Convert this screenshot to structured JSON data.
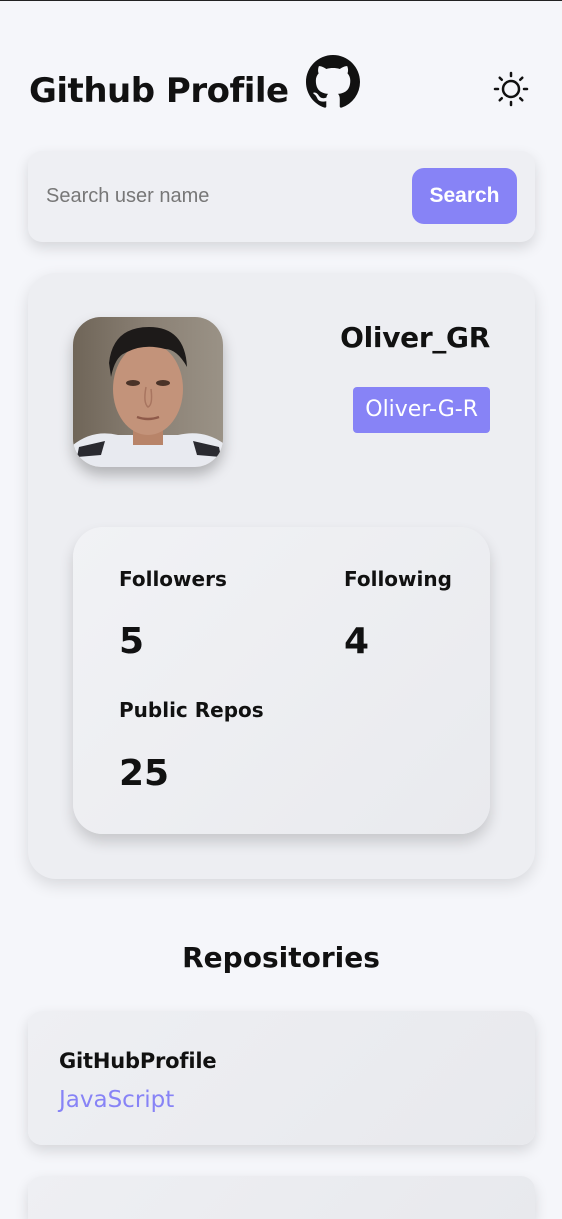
{
  "header": {
    "title": "Github Profile",
    "logo_icon": "github-octocat-icon",
    "theme_icon": "sun-icon"
  },
  "search": {
    "placeholder": "Search user name",
    "value": "",
    "button_label": "Search"
  },
  "profile": {
    "name": "Oliver_GR",
    "login": "Oliver-G-R",
    "avatar_alt": "Avatar"
  },
  "stats": {
    "followers_label": "Followers",
    "followers_value": "5",
    "following_label": "Following",
    "following_value": "4",
    "repos_label": "Public Repos",
    "repos_value": "25"
  },
  "repositories": {
    "heading": "Repositories",
    "items": [
      {
        "name": "GitHubProfile",
        "language": "JavaScript"
      },
      {
        "name": "",
        "language": ""
      }
    ]
  },
  "colors": {
    "accent": "#8783f6",
    "background": "#f5f6fa",
    "card": "#edeef2",
    "text": "#111111"
  }
}
